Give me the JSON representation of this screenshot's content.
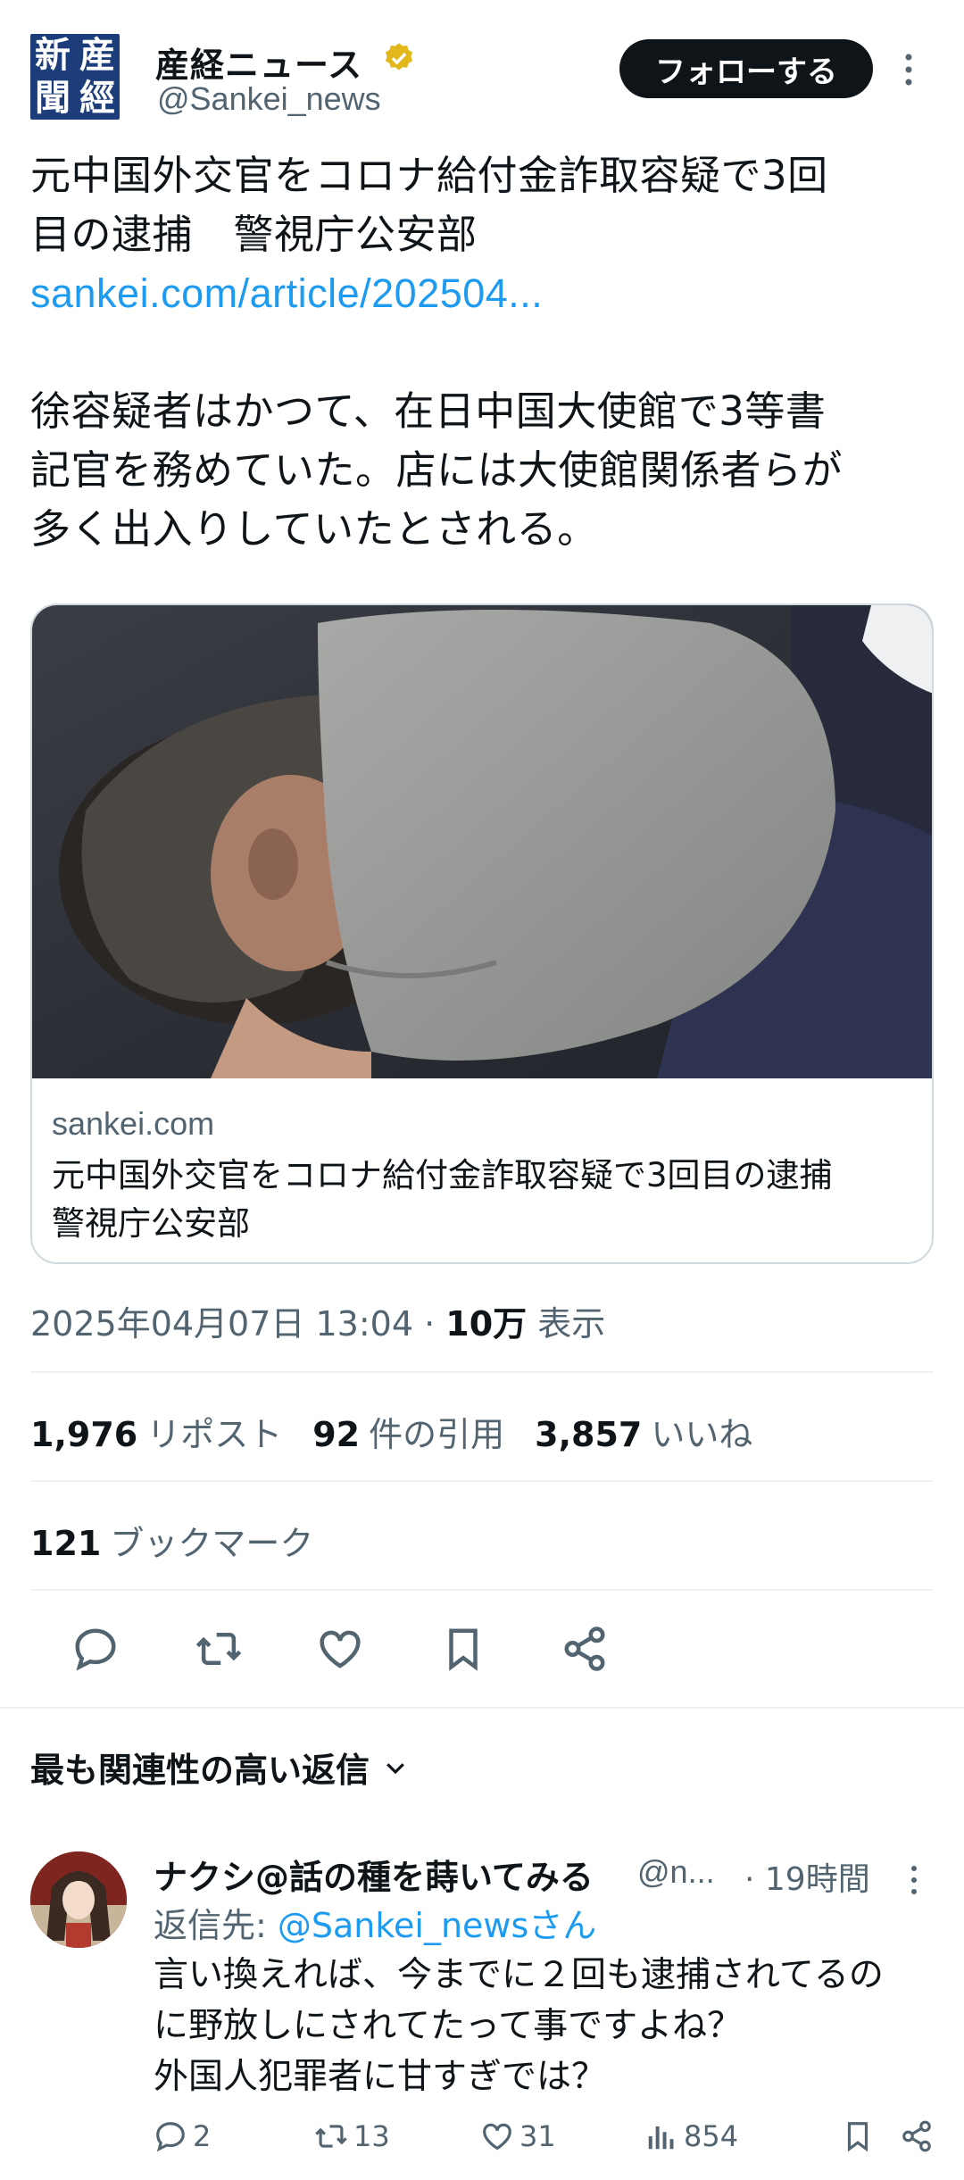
{
  "account": {
    "logo_chars": [
      "新",
      "産",
      "聞",
      "經"
    ],
    "name": "産経ニュース",
    "handle": "@Sankei_news",
    "follow_label": "フォローする"
  },
  "tweet": {
    "line1": "元中国外交官をコロナ給付金詐取容疑で3回",
    "line2": "目の逮捕　警視庁公安部",
    "link": "sankei.com/article/202504...",
    "body1": "徐容疑者はかつて、在日中国大使館で3等書",
    "body2": "記官を務めていた。店には大使館関係者らが",
    "body3": "多く出入りしていたとされる。"
  },
  "card": {
    "domain": "sankei.com",
    "title1": "元中国外交官をコロナ給付金詐取容疑で3回目の逮捕",
    "title2": "警視庁公安部"
  },
  "meta": {
    "timestamp": "2025年04月07日 13:04",
    "separator": " · ",
    "views_count": "10万",
    "views_label": "表示"
  },
  "stats": {
    "reposts_count": "1,976",
    "reposts_label": "リポスト",
    "quotes_count": "92",
    "quotes_label": "件の引用",
    "likes_count": "3,857",
    "likes_label": "いいね",
    "bookmarks_count": "121",
    "bookmarks_label": "ブックマーク"
  },
  "actions": [
    "reply-icon",
    "retweet-icon",
    "heart-icon",
    "bookmark-icon",
    "share-icon"
  ],
  "replies_header": "最も関連性の高い返信",
  "reply": {
    "name": "ナクシ@話の種を蒔いてみる",
    "handle": "@n...",
    "time": "· 19時間",
    "reply_to_prefix": "返信先: ",
    "reply_to_handle": "@Sankei_newsさん",
    "text1": "言い換えれば、今までに２回も逮捕されてるの",
    "text2": "に野放しにされてたって事ですよね？",
    "text3": "外国人犯罪者に甘すぎでは？",
    "replies": "2",
    "retweets": "13",
    "likes": "31",
    "views": "854"
  },
  "colors": {
    "link": "#1d9bf0",
    "secondary": "#536471",
    "verified": "#e2b719",
    "logo_bg": "#1d3d7a"
  }
}
